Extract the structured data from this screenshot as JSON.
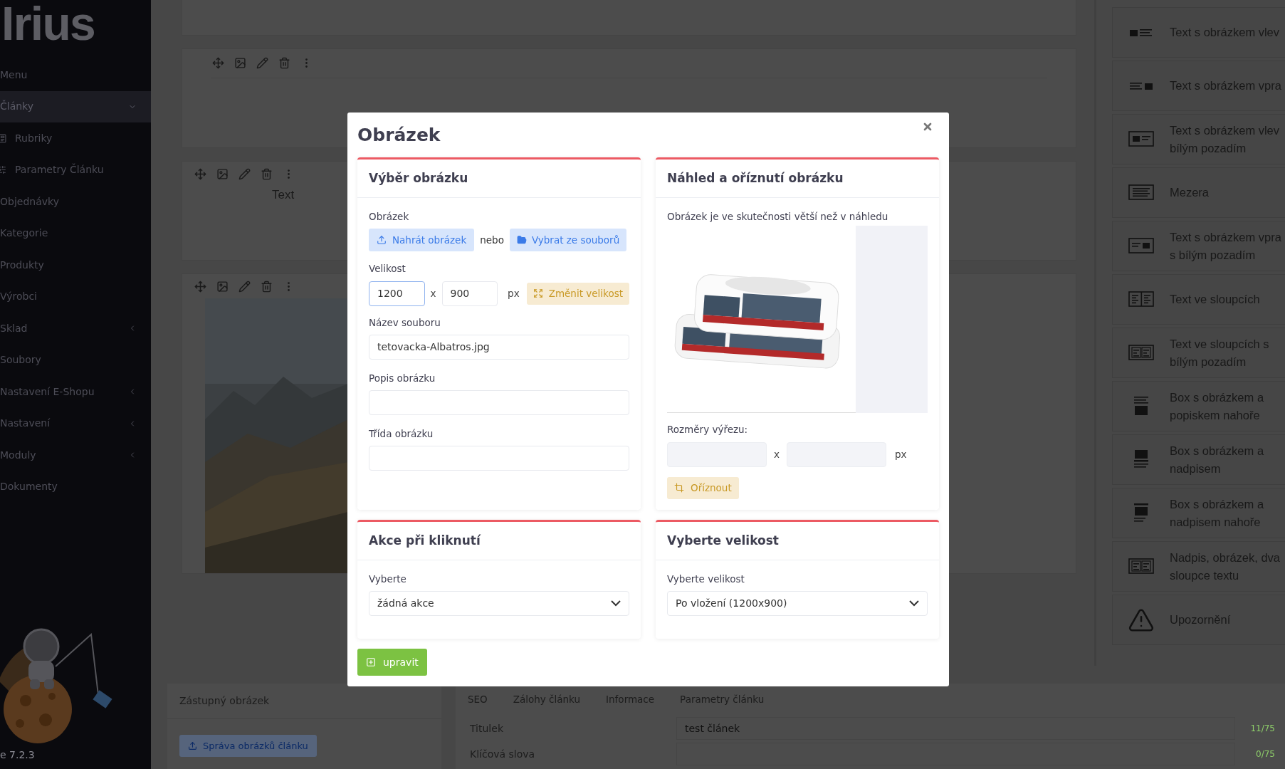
{
  "sidebar": {
    "logo": "Irius",
    "items": [
      {
        "label": "Menu",
        "kind": "heading",
        "selected": false
      },
      {
        "label": "Články",
        "kind": "group",
        "selected": true,
        "expanded": true,
        "children": [
          {
            "label": "Rubriky",
            "kind": "sections",
            "selected": false
          },
          {
            "label": "Parametry Článku",
            "kind": "params",
            "selected": false
          }
        ]
      },
      {
        "label": "Objednávky",
        "kind": "link",
        "selected": false
      },
      {
        "label": "Kategorie",
        "kind": "link",
        "selected": false
      },
      {
        "label": "Produkty",
        "kind": "link",
        "selected": false
      },
      {
        "label": "Výrobci",
        "kind": "link",
        "selected": false
      },
      {
        "label": "Sklad",
        "kind": "group",
        "selected": false,
        "expanded": false
      },
      {
        "label": "Soubory",
        "kind": "link",
        "selected": false
      },
      {
        "label": "Nastavení E-Shopu",
        "kind": "group",
        "selected": false,
        "expanded": false
      },
      {
        "label": "Nastavení",
        "kind": "group",
        "selected": false,
        "expanded": false
      },
      {
        "label": "Moduly",
        "kind": "group",
        "selected": false,
        "expanded": false
      },
      {
        "label": "Dokumenty",
        "kind": "link",
        "selected": false
      }
    ],
    "version": "e 7.2.3"
  },
  "editor": {
    "blocks": [
      {
        "kind": "empty"
      },
      {
        "kind": "text",
        "text": "Text"
      },
      {
        "kind": "picture"
      }
    ]
  },
  "block_palette": [
    {
      "kind": "imgleft",
      "label": "Text s obrázkem vlev"
    },
    {
      "kind": "imgright",
      "label": "Text s obrázkem vpra"
    },
    {
      "kind": "imgleftbox",
      "label": "Text s obrázkem vlev bílým pozadím"
    },
    {
      "kind": "spacer",
      "label": "Mezera"
    },
    {
      "kind": "imgrightbox",
      "label": "Text s obrázkem vpra s bílým pozadím"
    },
    {
      "kind": "columns",
      "label": "Text ve sloupcích"
    },
    {
      "kind": "columnsbox",
      "label": "Text ve sloupcích s bílým pozadím"
    },
    {
      "kind": "boxcaption",
      "label": "Box s obrázkem a popiskem nahoře"
    },
    {
      "kind": "boxtitle",
      "label": "Box s obrázkem a nadpisem"
    },
    {
      "kind": "boxtitletop",
      "label": "Box s obrázkem a nadpisem nahoře"
    },
    {
      "kind": "headcolumns",
      "label": "Nadpis, obrázek, dva sloupce textu"
    },
    {
      "kind": "warning",
      "label": "Upozornění"
    }
  ],
  "bottom": {
    "thumbnail": {
      "title": "Zástupný obrázek",
      "button": "Správa obrázků článku"
    },
    "tabs": [
      {
        "label": "SEO"
      },
      {
        "label": "Zálohy článku"
      },
      {
        "label": "Informace"
      },
      {
        "label": "Parametry článku"
      }
    ],
    "fields": [
      {
        "label": "Titulek",
        "value": "test článek",
        "counter": "11/75"
      },
      {
        "label": "Klíčová slova",
        "counter": "0/75"
      }
    ]
  },
  "dialog": {
    "title": "Obrázek",
    "image_selection": {
      "title": "Výběr obrázku",
      "image_label": "Obrázek",
      "upload_button": "Nahrát obrázek",
      "or": "nebo",
      "browse_button": "Vybrat ze souborů",
      "size_label": "Velikost",
      "width": {
        "value": "1200",
        "focused": true
      },
      "times": "x",
      "height": {
        "value": "900",
        "focused": false
      },
      "unit": "px",
      "resize_button": "Změnit velikost",
      "filename_label": "Název souboru",
      "filename": "tetovacka-Albatros.jpg",
      "description_label": "Popis obrázku",
      "class_label": "Třída obrázku"
    },
    "preview": {
      "title": "Náhled a oříznutí obrázku",
      "note": "Obrázek je ve skutečnosti větší než v náhledu",
      "crop_label": "Rozměry výřezu:",
      "times": "x",
      "unit": "px",
      "crop_button": "Oříznout"
    },
    "click_action": {
      "title": "Akce při kliknutí",
      "label": "Vyberte",
      "value": "žádná akce"
    },
    "size_select": {
      "title": "Vyberte velikost",
      "label": "Vyberte velikost",
      "value": "Po vložení (1200x900)"
    },
    "submit": "upravit"
  }
}
